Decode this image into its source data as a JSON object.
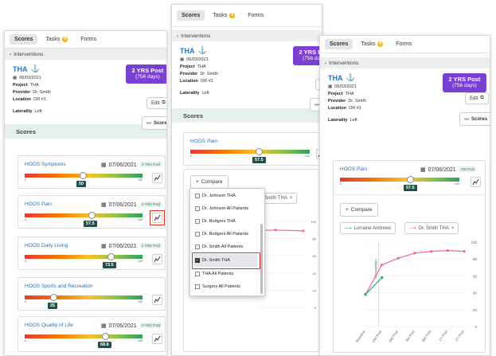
{
  "tabs": {
    "scores": "Scores",
    "tasks": "Tasks",
    "tasks_badge": "8",
    "forms": "Forms"
  },
  "interventions_label": "Interventions",
  "procedure": {
    "name": "THA",
    "date": "06/03/2021",
    "project_label": "Project",
    "project": "THA",
    "provider_label": "Provider",
    "provider": "Dr. Smith",
    "location_label": "Location",
    "location": "OR #1",
    "laterality_label": "Laterality",
    "laterality": "Left"
  },
  "post": {
    "main": "2 YRS Post",
    "days": "(756 days)"
  },
  "buttons": {
    "edit": "Edit",
    "scores": "Scores",
    "compare": "Compare"
  },
  "scores_heading": "Scores",
  "cards": [
    {
      "name": "HOOS Symptoms",
      "date": "07/06/2021",
      "post": "2 YRS Post",
      "value": 50
    },
    {
      "name": "HOOS Pain",
      "date": "07/06/2021",
      "post": "2 YRS Post",
      "value": 57.5
    },
    {
      "name": "HOOS Daily Living",
      "date": "07/06/2021",
      "post": "2 YRS Post",
      "value": 73.5
    },
    {
      "name": "HOOS Sports and Recreation",
      "date": "07/06/2021",
      "post": "2 YRS Post",
      "value": 25
    },
    {
      "name": "HOOS Quality of Life",
      "date": "07/06/2021",
      "post": "2 YRS Post",
      "value": 68.8
    }
  ],
  "scale": {
    "min": "0",
    "max": "100"
  },
  "panel2_card": {
    "name": "HOOS Pain",
    "date": "07/06/2021",
    "post": "2W Post",
    "value": 57.5
  },
  "panel3_card": {
    "name": "HOOS Pain",
    "date": "07/06/2021",
    "post": "2W Post",
    "value": 57.5
  },
  "compare_options": [
    "Dr. Johnson THA",
    "Dr. Johnson All Patients",
    "Dr. Rodgers THA",
    "Dr. Rodgers All Patients",
    "Dr. Smith All Patients",
    "Dr. Smith THA",
    "THA All Patients",
    "Surgery All Patients"
  ],
  "compare_checked": "Dr. Smith THA",
  "chips": {
    "lorraine": "Lorraine Andrews",
    "smith": "Dr. Smith THA",
    "smith_partial": "Smith THA"
  },
  "chart_data": {
    "type": "line",
    "x": [
      "Baseline",
      "2W Post",
      "6W Post",
      "3M Post",
      "6M Post",
      "1Y Post",
      "2Y Post"
    ],
    "ylim": [
      0,
      100
    ],
    "yticks": [
      0,
      20,
      40,
      60,
      80,
      100
    ],
    "annotation": "Intervention",
    "series": [
      {
        "name": "Dr. Smith THA",
        "color": "#f06b8a",
        "values": [
          38,
          73,
          81,
          87,
          89,
          90,
          89
        ]
      },
      {
        "name": "Lorraine Andrews",
        "color": "#28a38a",
        "values": [
          38,
          58,
          null,
          null,
          null,
          null,
          null
        ]
      }
    ]
  }
}
